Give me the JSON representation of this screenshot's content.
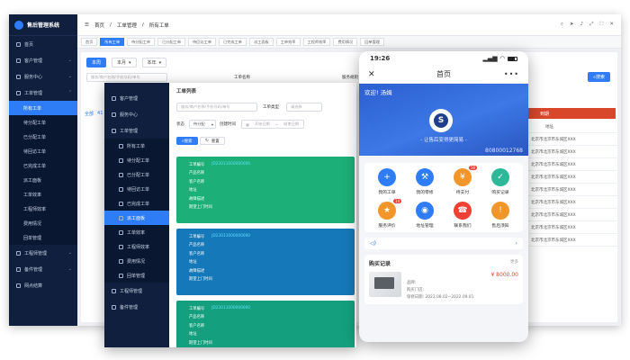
{
  "desktop": {
    "app_name": "售后管理系统",
    "breadcrumb": [
      "首页",
      "工单管理",
      "所有工单"
    ],
    "sidebar": [
      {
        "label": "首页"
      },
      {
        "label": "客户管理"
      },
      {
        "label": "服务中心"
      },
      {
        "label": "工单管理"
      }
    ],
    "sidebar_sub": [
      "所有工单",
      "待分配工单",
      "已分配工单",
      "待回访工单",
      "已完成工单",
      "派工面板",
      "工单效率",
      "工程师效率",
      "费用情况",
      "回单管理"
    ],
    "sidebar_tail": [
      "工程师管理",
      "备件管理",
      "网点结算"
    ],
    "tabs": [
      "首页",
      "所有工单",
      "待分配工单",
      "已分配工单",
      "待回访工单",
      "已完成工单",
      "派工面板",
      "工单效率",
      "工程师效率",
      "费用情况",
      "回单管理"
    ],
    "filter_btns": [
      "本周",
      "本月",
      "本年"
    ],
    "search_placeholder": "服务/商户名称/手机号码/单号",
    "labels": [
      "工单名称",
      "服务规则"
    ],
    "all_label": "全部",
    "all_count": "41",
    "search_btn": "搜索",
    "table_header_col": "地址",
    "status_col": "到期",
    "addresses": [
      "北京市北京市东城区XXX",
      "北京市北京市东城区XXX",
      "北京市北京市东城区XXX",
      "北京市北京市东城区XXX",
      "北京市北京市东城区XXX",
      "北京市北京市东城区XXX",
      "北京市北京市东城区XXX",
      "北京市北京市东城区XXX",
      "北京市北京市东城区XXX"
    ]
  },
  "middle": {
    "sidebar": [
      "客户管理",
      "服务中心",
      "工单管理"
    ],
    "sidebar_sub": [
      "所有工单",
      "待分配工单",
      "已分配工单",
      "待回访工单",
      "已完成工单",
      "派工面板",
      "工单效率",
      "工程师效率",
      "费用情况",
      "回单管理"
    ],
    "sidebar_tail": [
      "工程师管理",
      "备件管理"
    ],
    "title": "工单列表",
    "search_placeholder": "服务/商户名称/手机号码/单号",
    "type_label": "工单类型",
    "type_value": "请选择",
    "status_label": "状态",
    "status_value": "待分配",
    "created_label": "创建时间",
    "date_start": "开始日期",
    "date_end": "结束日期",
    "search_btn": "搜索",
    "reset_btn": "重置",
    "card_fields": [
      "工单编号",
      "产品名称",
      "客户名称",
      "地址",
      "故障描述",
      "期望上门时间"
    ],
    "card_number": "JD23011000000000",
    "card_colors": [
      "#1daf78",
      "#1578b8",
      "#14a07e"
    ]
  },
  "phone": {
    "time": "19:26",
    "title": "首页",
    "greeting": "欢迎! 汤姆",
    "slogan": "- 让售后变得更简易 -",
    "hotline": "80800012768",
    "grid": [
      {
        "label": "我的工单",
        "color": "#2e7cf6",
        "icon": "+",
        "badge": ""
      },
      {
        "label": "我的零修",
        "color": "#2e7cf6",
        "icon": "⚒",
        "badge": ""
      },
      {
        "label": "待支付",
        "color": "#f2962b",
        "icon": "¥",
        "badge": "56"
      },
      {
        "label": "购买记录",
        "color": "#2eb89a",
        "icon": "✓",
        "badge": ""
      },
      {
        "label": "服务评价",
        "color": "#f2962b",
        "icon": "★",
        "badge": "14"
      },
      {
        "label": "地址管理",
        "color": "#2e7cf6",
        "icon": "◉",
        "badge": ""
      },
      {
        "label": "联系我们",
        "color": "#f04134",
        "icon": "☎",
        "badge": ""
      },
      {
        "label": "售后须知",
        "color": "#f2962b",
        "icon": "!",
        "badge": ""
      }
    ],
    "record_title": "购买记录",
    "record_more": "更多",
    "price": "¥ 8000.00",
    "product_line1": "品牌:",
    "product_line2": "购买门店:",
    "product_line3": "保修日期: 2022.08.02~2022.09.01"
  }
}
